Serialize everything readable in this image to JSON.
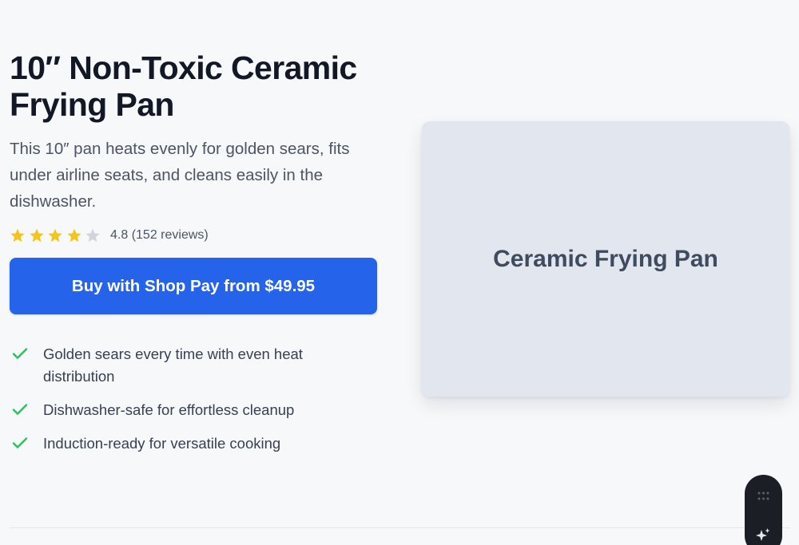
{
  "product": {
    "title": "10″ Non-Toxic Ceramic Frying Pan",
    "description": "This 10″ pan heats evenly for golden sears, fits under airline seats, and cleans easily in the dishwasher.",
    "rating": {
      "score": 4.8,
      "max": 5,
      "filled_stars": 4,
      "text": "4.8 (152 reviews)"
    },
    "buy_button_label": "Buy with Shop Pay from $49.95",
    "features": [
      "Golden sears every time with even heat distribution",
      "Dishwasher-safe for effortless cleanup",
      "Induction-ready for versatile cooking"
    ],
    "image_label": "Ceramic Frying Pan"
  },
  "widget": {
    "top_icon": "grid-dots-icon",
    "bottom_icon": "sparkle-icon"
  },
  "colors": {
    "accent": "#2563eb",
    "star_filled": "#f5c518",
    "star_empty": "#d1d5db",
    "check": "#22c55e",
    "background": "#f7f8fa",
    "image_bg": "#e2e7ef"
  }
}
